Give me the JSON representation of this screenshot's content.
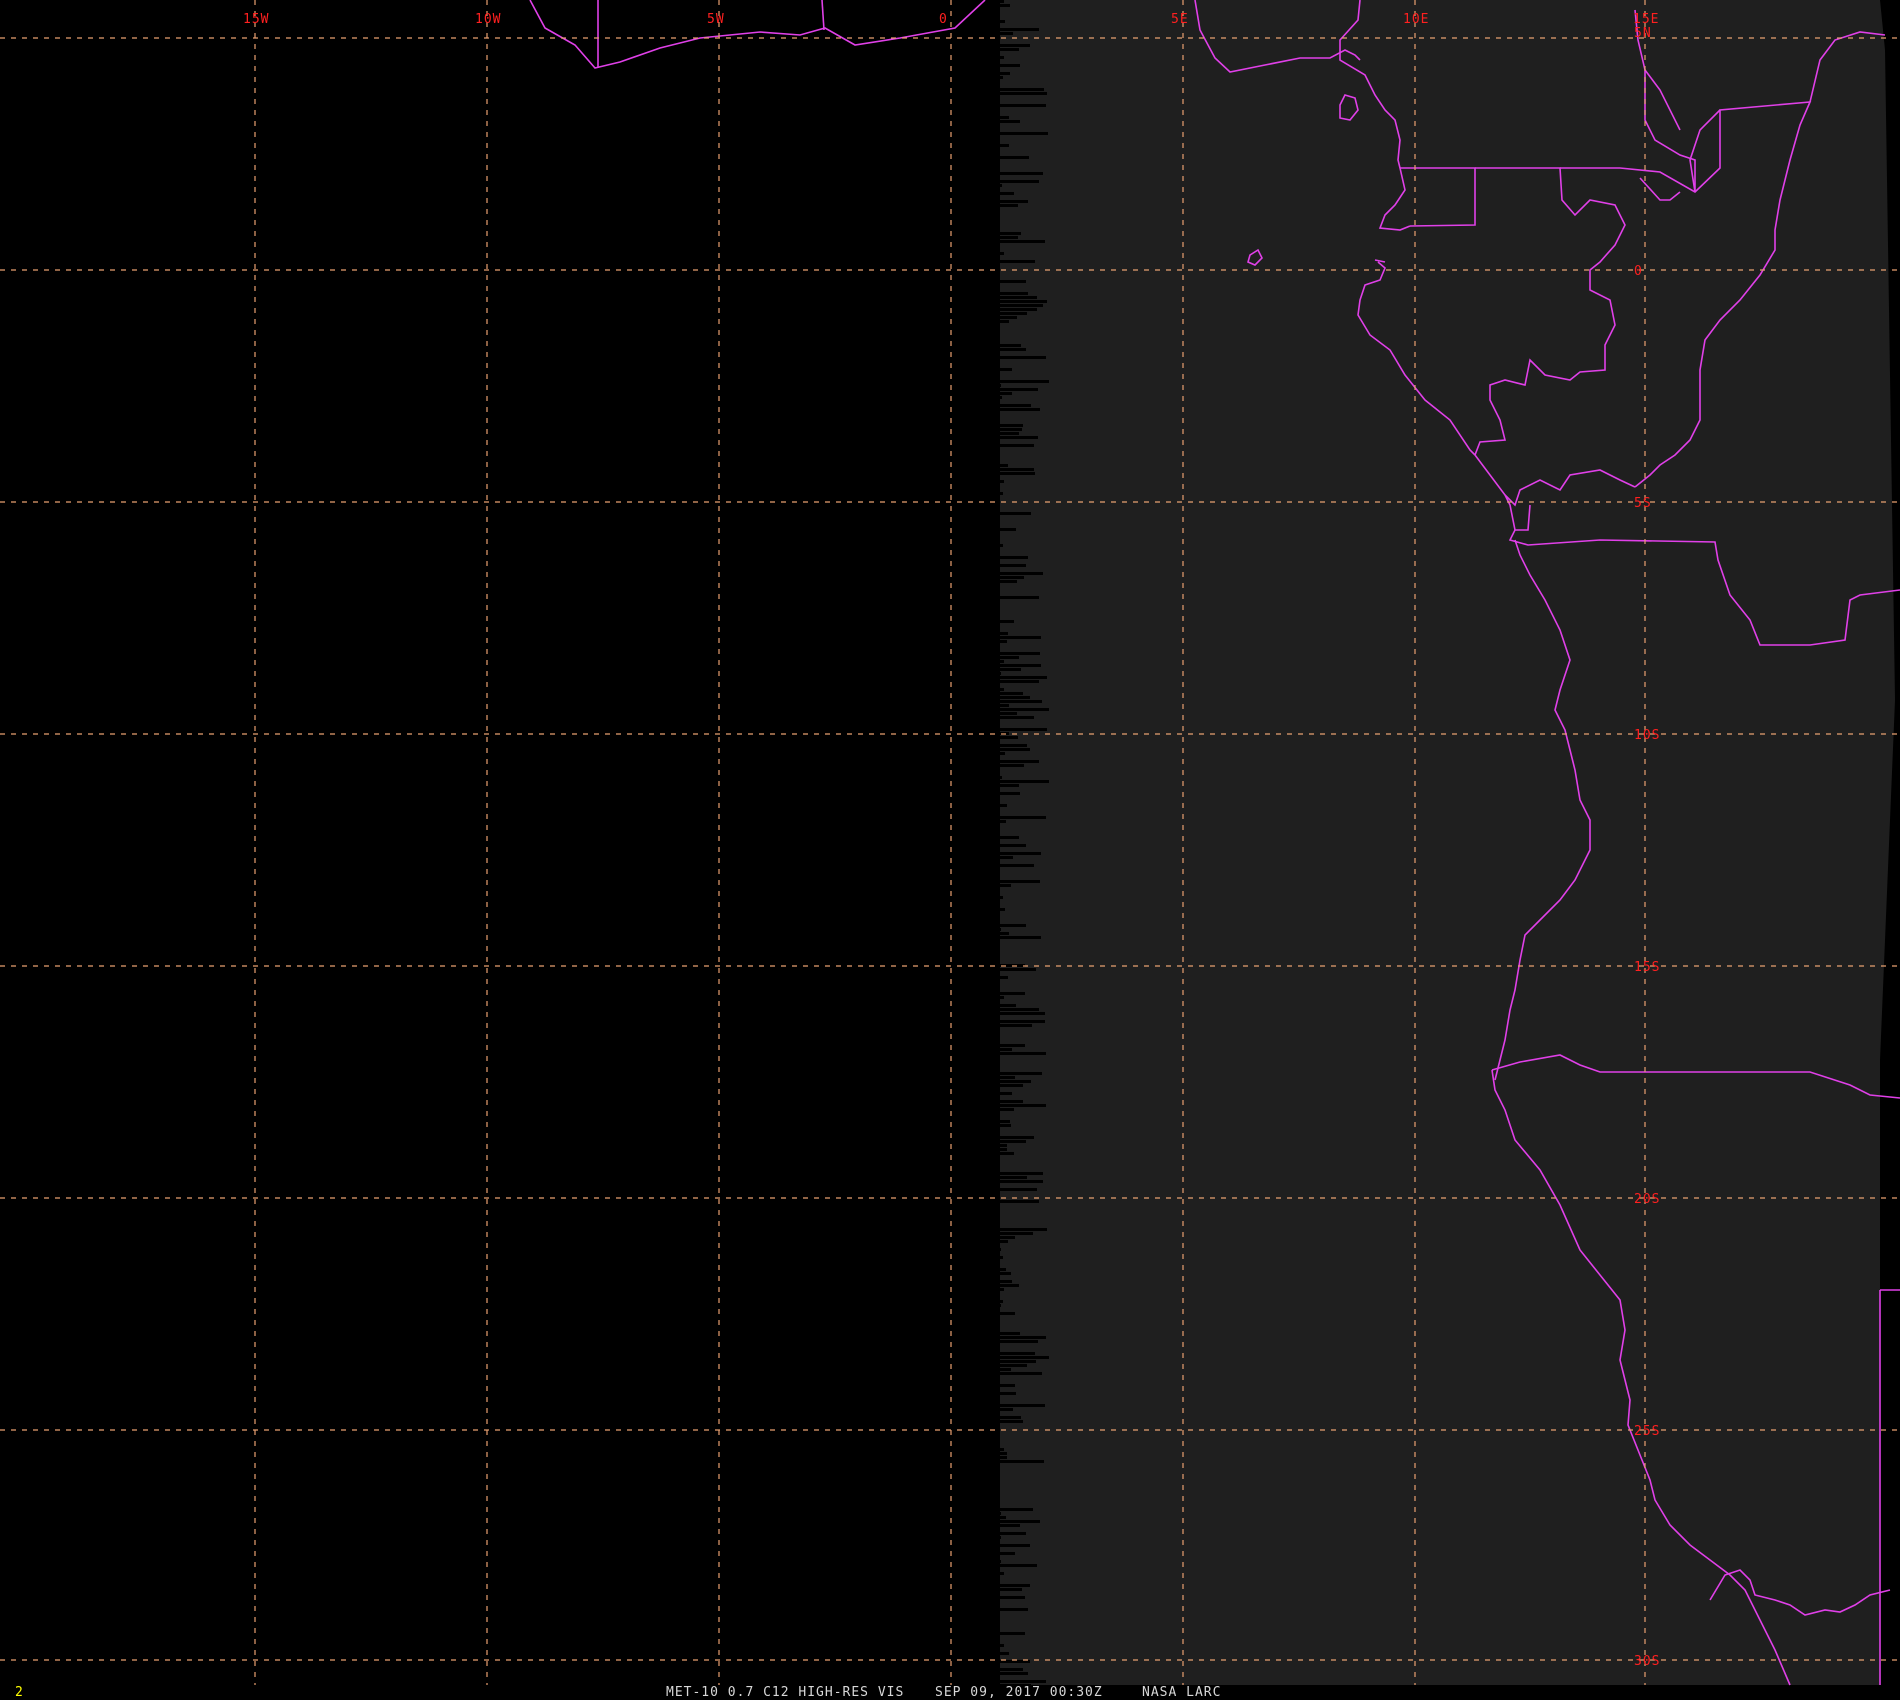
{
  "colors": {
    "background": "#000000",
    "disk": "#1f1f1f",
    "grid": "#e8a070",
    "borders": "#e040e8",
    "grid_label": "#ff2020",
    "caption": "#d8d8d8",
    "frame_number": "#ffff00"
  },
  "grid": {
    "longitudes": [
      {
        "label": "15W"
      },
      {
        "label": "10W"
      },
      {
        "label": "5W"
      },
      {
        "label": "0"
      },
      {
        "label": "5E"
      },
      {
        "label": "10E"
      },
      {
        "label": "15E"
      }
    ],
    "latitudes": [
      {
        "label": "5N"
      },
      {
        "label": "0"
      },
      {
        "label": "5S"
      },
      {
        "label": "10S"
      },
      {
        "label": "15S"
      },
      {
        "label": "20S"
      },
      {
        "label": "25S"
      },
      {
        "label": "30S"
      }
    ]
  },
  "caption": {
    "product": "MET-10 0.7 C12 HIGH-RES VIS",
    "datetime": "SEP 09, 2017 00:30Z",
    "source": "NASA LARC"
  },
  "frame_number": "2",
  "icons": {
    "coastline": "coastline-icon",
    "country_border": "country-border-icon"
  }
}
